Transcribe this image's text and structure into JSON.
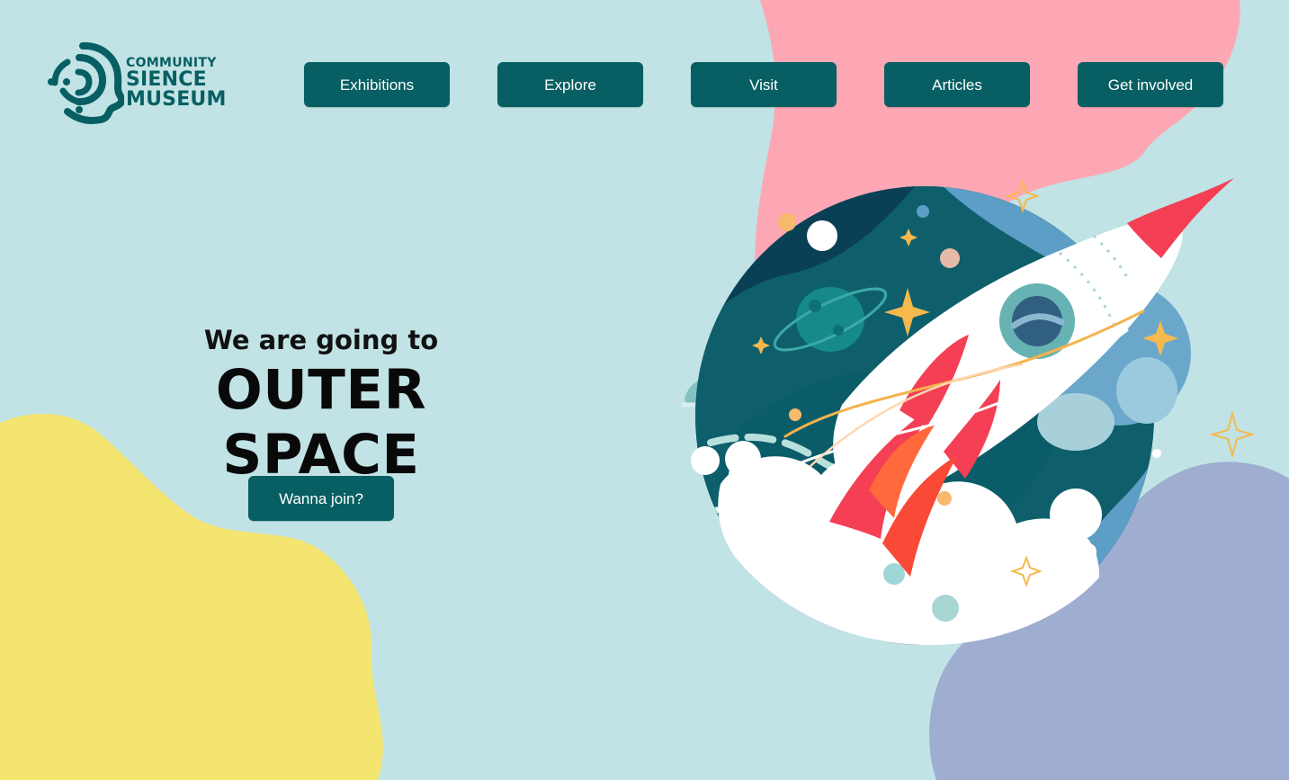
{
  "brand": {
    "line_1": "COMMUNITY",
    "line_2": "SIENCE",
    "line_3": "MUSEUM",
    "icon": "brain-head-icon"
  },
  "navigation": {
    "items": [
      {
        "label": "Exhibitions"
      },
      {
        "label": "Explore"
      },
      {
        "label": "Visit"
      },
      {
        "label": "Articles"
      },
      {
        "label": "Get involved"
      }
    ]
  },
  "hero": {
    "subtitle": "We are going to",
    "title": "OUTER SPACE",
    "cta": "Wanna join?"
  },
  "theme": {
    "background": "#c1e3e5",
    "button": "#075f63",
    "button_text": "#ffffff",
    "pink_blob": "#fea7b4",
    "yellow_blob": "#f4e570",
    "purple_blob": "#9eadd0"
  },
  "illustration": {
    "icons": [
      "rocket-icon",
      "planet-icon",
      "moon-icon",
      "stars-icon",
      "cloud-icon"
    ]
  }
}
